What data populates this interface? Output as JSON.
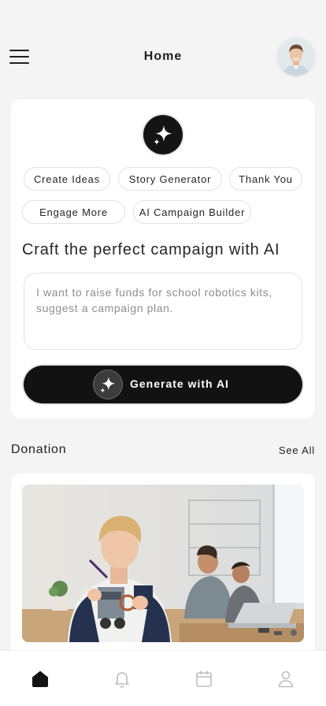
{
  "header": {
    "title": "Home",
    "menu_icon": "hamburger-menu-icon",
    "avatar": "user-avatar"
  },
  "ai_panel": {
    "badge_icon": "sparkle-icon",
    "chips": [
      "Create Ideas",
      "Story Generator",
      "Thank You",
      "Engage More",
      "AI Campaign Builder"
    ],
    "heading": "Craft the perfect campaign with AI",
    "prompt_placeholder": "I want to raise funds for school robotics kits, suggest a campaign plan.",
    "prompt_value": "",
    "generate_label": "Generate with AI"
  },
  "donation": {
    "title": "Donation",
    "see_all": "See All",
    "image": "photo of children building robotics kits in a classroom"
  },
  "tabbar": {
    "items": [
      "home-icon",
      "bell-icon",
      "calendar-icon",
      "profile-icon"
    ],
    "active": "home-icon"
  },
  "colors": {
    "background": "#f4f4f4",
    "card": "#ffffff",
    "accent": "#121212",
    "muted_text": "#8e8e8e"
  }
}
